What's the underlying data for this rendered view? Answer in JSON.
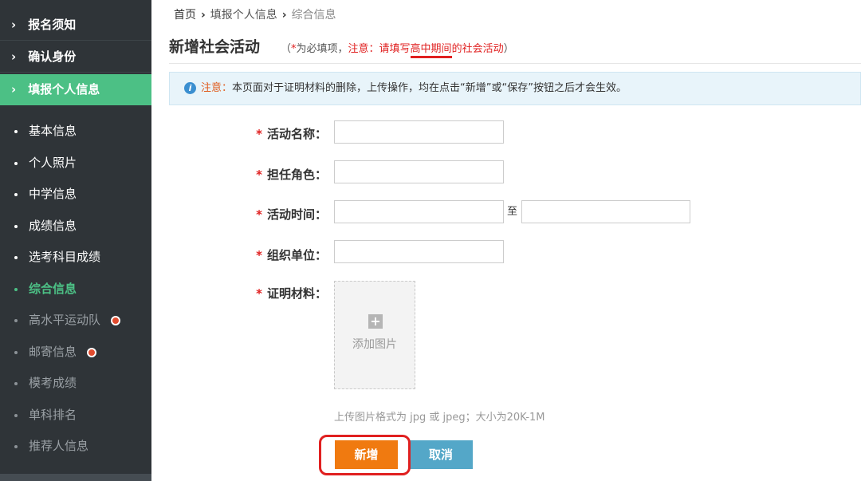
{
  "sidebar": {
    "sections": [
      {
        "label": "报名须知",
        "chevron": "›"
      },
      {
        "label": "确认身份",
        "chevron": "›"
      },
      {
        "label": "填报个人信息",
        "chevron": "›"
      }
    ],
    "items": [
      {
        "label": "基本信息"
      },
      {
        "label": "个人照片"
      },
      {
        "label": "中学信息"
      },
      {
        "label": "成绩信息"
      },
      {
        "label": "选考科目成绩"
      },
      {
        "label": "综合信息"
      },
      {
        "label": "高水平运动队"
      },
      {
        "label": "邮寄信息"
      },
      {
        "label": "模考成绩"
      },
      {
        "label": "单科排名"
      },
      {
        "label": "推荐人信息"
      }
    ]
  },
  "breadcrumb": {
    "home": "首页",
    "step": "填报个人信息",
    "current": "综合信息",
    "sep": "›"
  },
  "page": {
    "title": "新增社会活动",
    "note_open": "（",
    "note_star": "*",
    "note_required": "为必填项，",
    "note_attention": "注意：请填写",
    "note_emphasis": "高中期间",
    "note_tail": "的社会活动",
    "note_close": "）"
  },
  "notice": {
    "icon": "i",
    "label": "注意：",
    "text": "本页面对于证明材料的删除，上传操作，均在点击“新增”或“保存”按钮之后才会生效。"
  },
  "form": {
    "star": "*",
    "activity_name": {
      "label": "活动名称：",
      "value": ""
    },
    "role": {
      "label": "担任角色：",
      "value": ""
    },
    "time": {
      "label": "活动时间：",
      "from": "",
      "to_label": "至",
      "to": ""
    },
    "organization": {
      "label": "组织单位：",
      "value": ""
    },
    "material": {
      "label": "证明材料："
    },
    "upload": {
      "icon": "+",
      "label": "添加图片"
    },
    "hint": "上传图片格式为 jpg 或 jpeg；大小为20K-1M"
  },
  "buttons": {
    "add": "新增",
    "cancel": "取消"
  },
  "colors": {
    "sidebar_bg": "#2f3438",
    "active_green": "#4cc085",
    "add_orange": "#f07a10",
    "cancel_blue": "#54a7c8",
    "required_red": "#e02020"
  }
}
